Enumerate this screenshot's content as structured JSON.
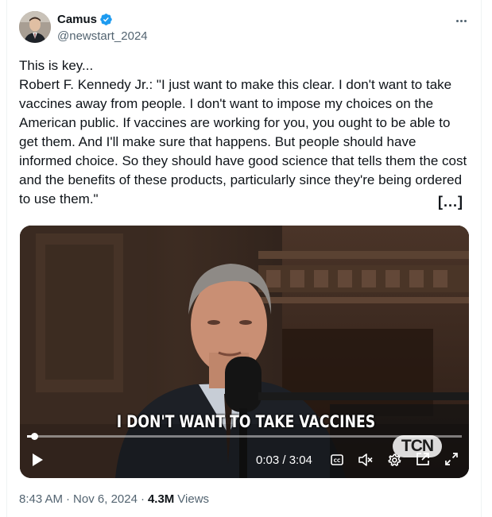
{
  "author": {
    "name": "Camus",
    "handle": "@newstart_2024",
    "verified": true,
    "verified_color": "#1d9bf0"
  },
  "tweet": {
    "text": "This is key...\nRobert F. Kennedy Jr.: \"I just want to make this clear. I don't want to take vaccines away from people. I don't want to impose my choices on the American public. If vaccines are working for you, you ought to be able to get them. And I'll make sure that happens. But people should have informed choice. So they should have good science that tells them the cost and the benefits of these products, particularly since they're being ordered to use them.\"",
    "expand_label": "[...]"
  },
  "video": {
    "caption": "I DON'T WANT TO TAKE VACCINES",
    "watermark": "TCN",
    "current_time": "0:03",
    "duration": "3:04",
    "time_display": "0:03 / 3:04",
    "progress_fraction": 0.016,
    "icons": [
      "play-icon",
      "captions-icon",
      "mute-icon",
      "settings-icon",
      "popout-icon",
      "fullscreen-icon"
    ]
  },
  "meta": {
    "time": "8:43 AM",
    "date": "Nov 6, 2024",
    "views_count": "4.3M",
    "views_label": "Views",
    "separator": "·"
  }
}
